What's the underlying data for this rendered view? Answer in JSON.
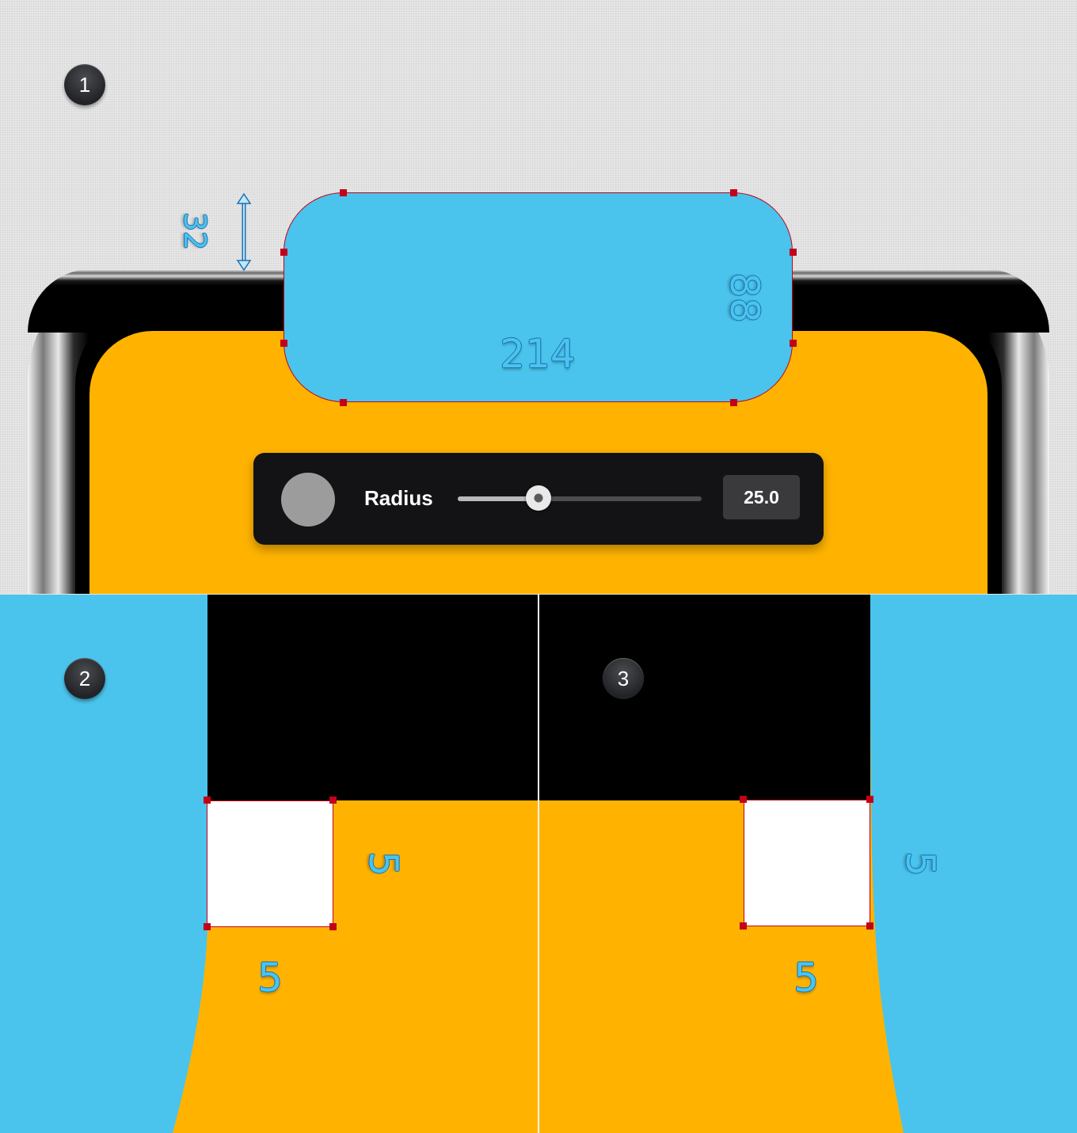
{
  "steps": {
    "step1": "1",
    "step2": "2",
    "step3": "3"
  },
  "dimensions": {
    "offset_top": "32",
    "rect_width": "214",
    "rect_height": "88"
  },
  "radius_panel": {
    "label": "Radius",
    "value": "25.0",
    "slider_fraction": 0.33
  },
  "panel2": {
    "square_width": "5",
    "square_height": "5"
  },
  "panel3": {
    "square_width": "5",
    "square_height": "5"
  },
  "colors": {
    "blue": "#4ac4ec",
    "orange": "#ffb300",
    "anchor_red": "#c3001a",
    "panel_dark": "#131315"
  },
  "icons": [
    "double-arrow-icon"
  ]
}
